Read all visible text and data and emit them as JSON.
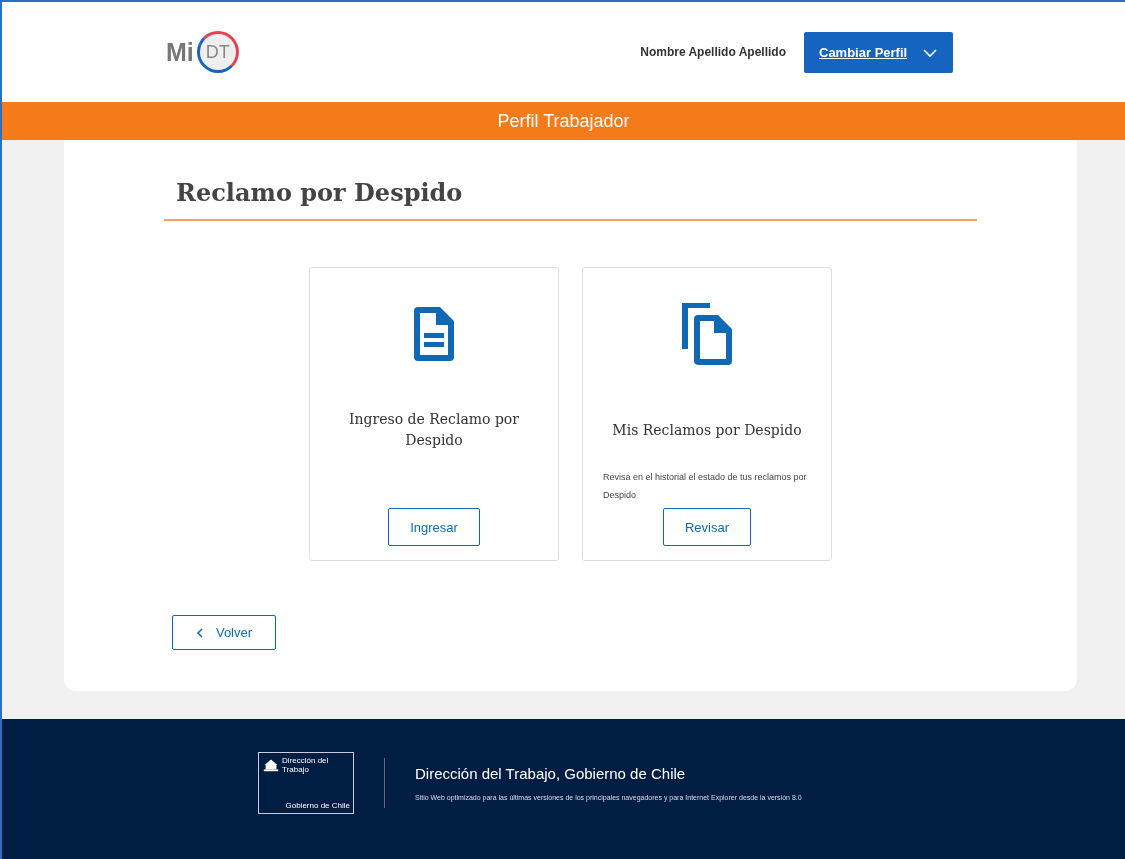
{
  "header": {
    "logo": {
      "prefix": "Mi",
      "badge": "DT"
    },
    "user_name": "Nombre Apellido Apellido",
    "profile_button": {
      "label": "Cambiar Perfil"
    }
  },
  "profile_bar": {
    "title": "Perfil Trabajador"
  },
  "page": {
    "title": "Reclamo por Despido",
    "cards": [
      {
        "kind": "document",
        "title": "Ingreso de Reclamo por Despido",
        "button": "Ingresar"
      },
      {
        "kind": "copies",
        "title": "Mis Reclamos por Despido",
        "description": "Revisa en el historial el estado de tus reclamos por Despido",
        "button": "Revisar"
      }
    ],
    "back_button": {
      "label": "Volver"
    }
  },
  "footer": {
    "logo": {
      "top": "Dirección del Trabajo",
      "bottom": "Gobierno de Chile"
    },
    "title": "Dirección del Trabajo, Gobierno de Chile",
    "note": "Sitio Web optimizado para las últimas versiones de los principales navegadores y para Internet Explorer desde la versión 8.0"
  }
}
